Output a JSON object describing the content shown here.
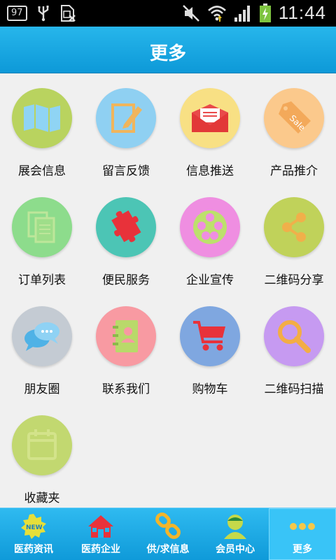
{
  "status": {
    "notification_badge": "97",
    "time": "11:44"
  },
  "header": {
    "title": "更多"
  },
  "grid": {
    "items": [
      {
        "label": "展会信息",
        "icon": "map-icon",
        "color": "#b9d35f"
      },
      {
        "label": "留言反馈",
        "icon": "pencil-icon",
        "color": "#8fd0f2"
      },
      {
        "label": "信息推送",
        "icon": "envelope-icon",
        "color": "#f8e084"
      },
      {
        "label": "产品推介",
        "icon": "sale-tag-icon",
        "color": "#fbc98c"
      },
      {
        "label": "订单列表",
        "icon": "documents-icon",
        "color": "#8ddc8c"
      },
      {
        "label": "便民服务",
        "icon": "puzzle-icon",
        "color": "#4cc5b5"
      },
      {
        "label": "企业宣传",
        "icon": "film-reel-icon",
        "color": "#ef8ee1"
      },
      {
        "label": "二维码分享",
        "icon": "share-icon",
        "color": "#c0d25a"
      },
      {
        "label": "朋友圈",
        "icon": "chat-bubbles-icon",
        "color": "#c4cbd3"
      },
      {
        "label": "联系我们",
        "icon": "contact-book-icon",
        "color": "#f89aa2"
      },
      {
        "label": "购物车",
        "icon": "shopping-cart-icon",
        "color": "#7fa7e0"
      },
      {
        "label": "二维码扫描",
        "icon": "magnifier-icon",
        "color": "#c69af1"
      },
      {
        "label": "收藏夹",
        "icon": "calendar-icon",
        "color": "#c2d870"
      }
    ]
  },
  "tabs": [
    {
      "label": "医药资讯",
      "icon": "new-badge-icon"
    },
    {
      "label": "医药企业",
      "icon": "house-icon"
    },
    {
      "label": "供/求信息",
      "icon": "chain-link-icon"
    },
    {
      "label": "会员中心",
      "icon": "member-icon"
    },
    {
      "label": "更多",
      "icon": "more-dots-icon",
      "active": true
    }
  ]
}
